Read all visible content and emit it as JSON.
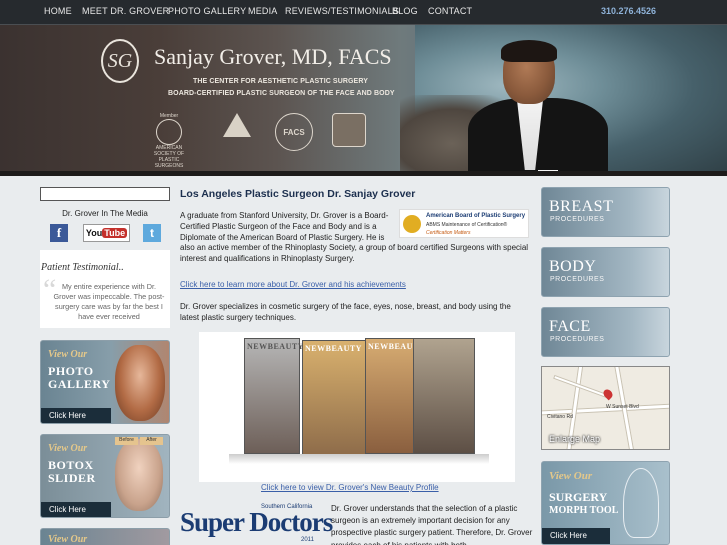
{
  "nav": {
    "items": [
      "HOME",
      "MEET DR. GROVER",
      "PHOTO GALLERY",
      "MEDIA",
      "REVIEWS/TESTIMONIALS",
      "BLOG",
      "CONTACT"
    ],
    "phone": "310.276.4526"
  },
  "banner": {
    "logo_mark": "SG",
    "doctor_name": "Sanjay Grover, MD, FACS",
    "tagline1": "THE CENTER FOR AESTHETIC PLASTIC SURGERY",
    "tagline2": "BOARD-CERTIFIED PLASTIC SURGEON OF THE FACE AND BODY",
    "badges": [
      "Member",
      "AMERICAN SOCIETY OF PLASTIC SURGEONS",
      "FACS"
    ]
  },
  "sidebar": {
    "media_title": "Dr. Grover In The Media",
    "social": {
      "facebook": "f",
      "youtube_you": "You",
      "youtube_tube": "Tube",
      "twitter": "t"
    },
    "testimonial": {
      "heading": "Patient Testimonial..",
      "quote_mark": "“",
      "text": "My entire experience with Dr. Grover was impeccable. The post-surgery care was by far the best I have ever received"
    },
    "promo_photo": {
      "view": "View Our",
      "line1": "PHOTO",
      "line2": "GALLERY",
      "click": "Click Here"
    },
    "promo_botox": {
      "view": "View Our",
      "line1": "BOTOX",
      "line2": "SLIDER",
      "click": "Click Here",
      "tab1": "Before",
      "tab2": "After"
    },
    "promo_bottom": {
      "view": "View Our"
    }
  },
  "main": {
    "title": "Los Angeles Plastic Surgeon Dr. Sanjay Grover",
    "p1": "A graduate from Stanford University, Dr. Grover is a Board-Certified Plastic Surgeon of the Face and Body and is a Diplomate of the American Board of Plastic Surgery. He is also an active member of the Rhinoplasty Society, a group of board certified Surgeons with special interest and qualifications in Rhinoplasty Surgery.",
    "abps": {
      "line1": "American Board of Plastic Surgery",
      "line2": "ABMS Maintenance of Certification®",
      "line3": "Certification Matters"
    },
    "link1": "Click here to learn more about Dr. Grover and his achievements",
    "p2": "Dr. Grover specializes in cosmetic surgery of the face, eyes, nose, breast, and body using the latest plastic surgery techniques.",
    "magazines": [
      "NEWBEAUTY",
      "NEWBEAUTY",
      "NEWBEAUTY"
    ],
    "link2": "Click here to view Dr. Grover's New Beauty Profile",
    "superdoctors": {
      "region": "Southern California",
      "name": "Super Doctors",
      "year": "2011"
    },
    "p3": "Dr. Grover understands that the selection of a plastic surgeon is an extremely important decision for any prospective plastic surgery patient. Therefore, Dr. Grover provides each of his patients with both"
  },
  "right": {
    "procedures": [
      {
        "name": "BREAST",
        "sub": "PROCEDURES"
      },
      {
        "name": "BODY",
        "sub": "PROCEDURES"
      },
      {
        "name": "FACE",
        "sub": "PROCEDURES"
      }
    ],
    "map": {
      "enlarge": "Enlarge Map",
      "street1": "W Sunset Blvd",
      "street2": "Civitano Rd"
    },
    "morph": {
      "view": "View Our",
      "line1": "SURGERY",
      "line2": "MORPH TOOL",
      "click": "Click Here"
    }
  }
}
